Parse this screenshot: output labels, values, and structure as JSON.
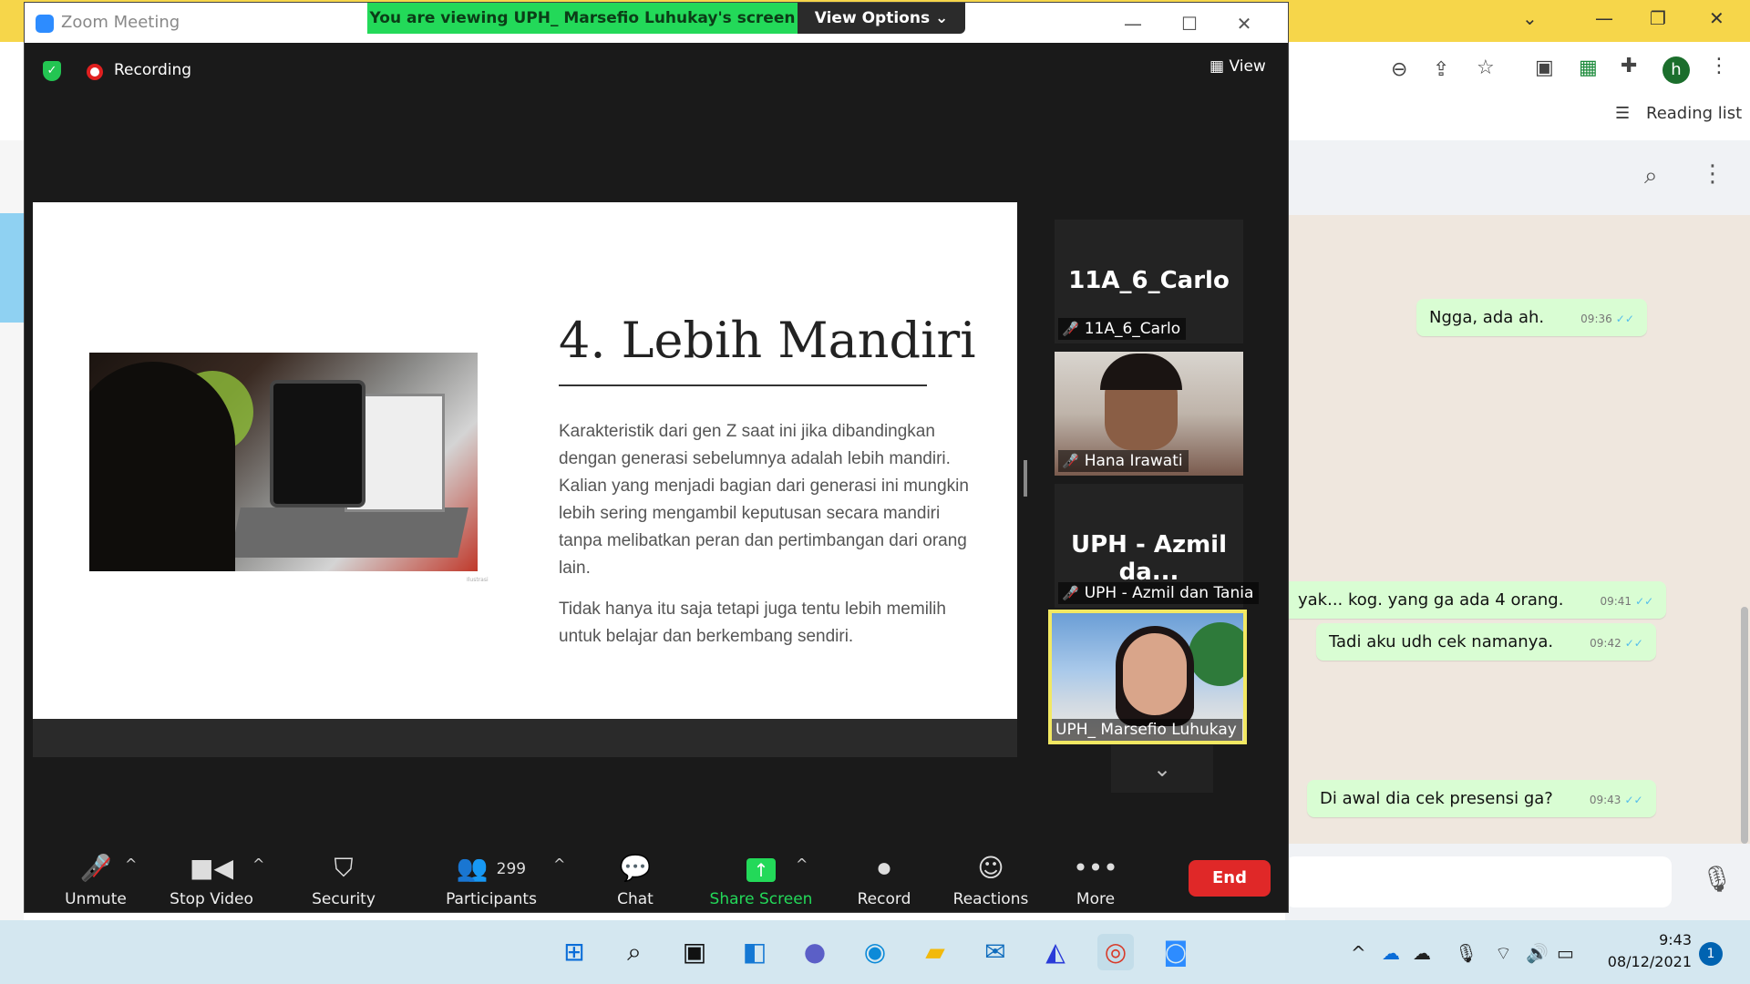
{
  "chrome": {
    "reading_list": "Reading list",
    "avatar_letter": "h"
  },
  "whatsapp": {
    "messages": [
      {
        "text": "Ngga, ada ah.",
        "time": "09:36"
      },
      {
        "text": "yak... kog. yang ga ada 4 orang.",
        "time": "09:41"
      },
      {
        "text": "Tadi aku udh cek namanya.",
        "time": "09:42"
      },
      {
        "text": "Di awal dia cek presensi ga?",
        "time": "09:43"
      }
    ]
  },
  "zoom": {
    "title": "Zoom Meeting",
    "banner": "You are viewing UPH_ Marsefio Luhukay's screen",
    "view_options": "View Options",
    "recording": "Recording",
    "view": "View",
    "slide": {
      "title": "4. Lebih Mandiri",
      "paragraph1": "Karakteristik dari gen Z saat ini jika dibandingkan dengan generasi sebelumnya adalah lebih mandiri. Kalian yang menjadi bagian dari generasi ini mungkin lebih sering mengambil keputusan secara mandiri tanpa melibatkan peran dan pertimbangan dari orang lain.",
      "paragraph2": "Tidak hanya itu saja tetapi juga tentu lebih memilih untuk belajar dan berkembang sendiri.",
      "photo_caption": "Ilustrasi"
    },
    "participants_panel": [
      {
        "big_name": "11A_6_Carlo",
        "label": "11A_6_Carlo"
      },
      {
        "big_name": "",
        "label": "Hana Irawati"
      },
      {
        "big_name": "UPH - Azmil da...",
        "label": "UPH - Azmil dan Tania"
      },
      {
        "big_name": "",
        "label": "UPH_ Marsefio Luhukay"
      }
    ],
    "toolbar": {
      "unmute": "Unmute",
      "stop_video": "Stop Video",
      "security": "Security",
      "participants": "Participants",
      "participant_count": "299",
      "chat": "Chat",
      "share_screen": "Share Screen",
      "record": "Record",
      "reactions": "Reactions",
      "more": "More",
      "end": "End"
    },
    "accent_share": "#23d959",
    "end_color": "#e02828"
  },
  "taskbar": {
    "time": "9:43",
    "date": "08/12/2021",
    "notifications": "1"
  }
}
